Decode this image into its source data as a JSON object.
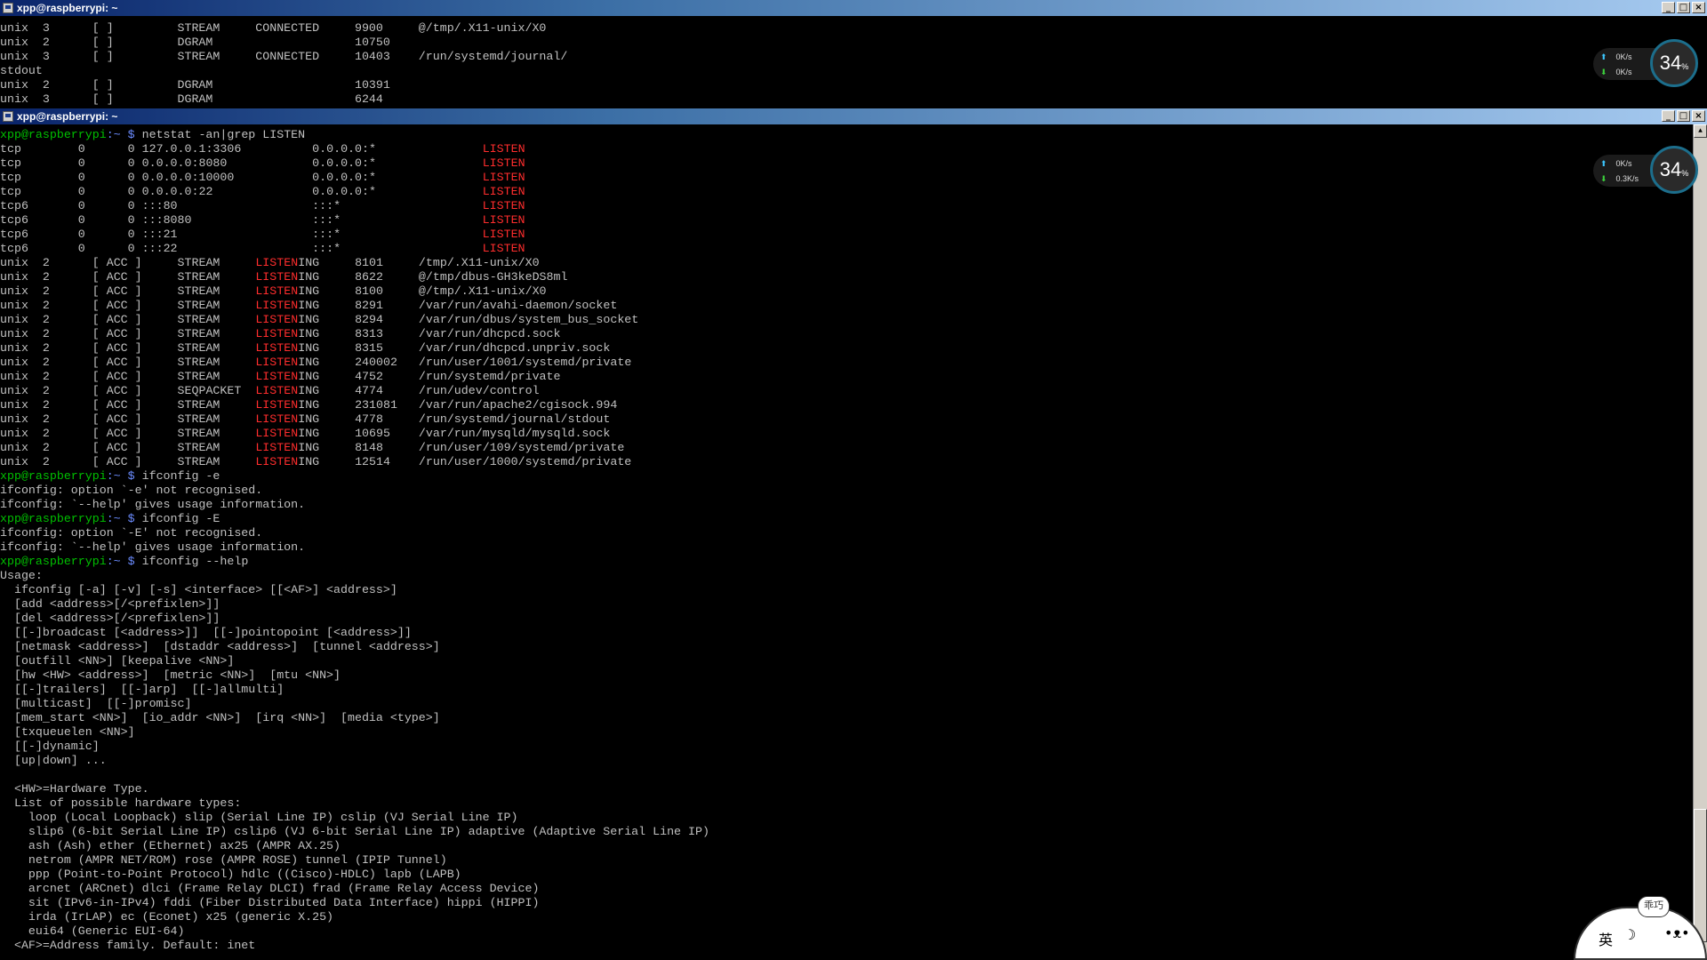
{
  "windows": [
    {
      "title": "xpp@raspberrypi: ~",
      "controls": {
        "minimize": "_",
        "maximize": "□",
        "close": "×"
      },
      "lines": [
        "unix  3      [ ]         STREAM     CONNECTED     9900     @/tmp/.X11-unix/X0",
        "unix  2      [ ]         DGRAM                    10750",
        "unix  3      [ ]         STREAM     CONNECTED     10403    /run/systemd/journal/",
        "stdout",
        "unix  2      [ ]         DGRAM                    10391",
        "unix  3      [ ]         DGRAM                    6244"
      ],
      "network": {
        "upload": "0K/s",
        "download": "0K/s",
        "gauge": "34",
        "gauge_unit": "%"
      }
    },
    {
      "title": "xpp@raspberrypi: ~",
      "controls": {
        "minimize": "_",
        "maximize": "□",
        "close": "×"
      },
      "network": {
        "upload": "0K/s",
        "download": "0.3K/s",
        "gauge": "34",
        "gauge_unit": "%"
      }
    }
  ],
  "prompt": {
    "user_host": "xpp@raspberrypi",
    "path": ":~ $ "
  },
  "commands": {
    "netstat": "netstat -an|grep LISTEN",
    "ifconfig_e": "ifconfig -e",
    "ifconfig_E": "ifconfig -E",
    "ifconfig_help": "ifconfig --help"
  },
  "tcp_listen": [
    {
      "proto": "tcp",
      "recvq": "0",
      "sendq": "0",
      "local": "127.0.0.1:3306",
      "foreign": "0.0.0.0:*",
      "state": "LISTEN"
    },
    {
      "proto": "tcp",
      "recvq": "0",
      "sendq": "0",
      "local": "0.0.0.0:8080",
      "foreign": "0.0.0.0:*",
      "state": "LISTEN"
    },
    {
      "proto": "tcp",
      "recvq": "0",
      "sendq": "0",
      "local": "0.0.0.0:10000",
      "foreign": "0.0.0.0:*",
      "state": "LISTEN"
    },
    {
      "proto": "tcp",
      "recvq": "0",
      "sendq": "0",
      "local": "0.0.0.0:22",
      "foreign": "0.0.0.0:*",
      "state": "LISTEN"
    },
    {
      "proto": "tcp6",
      "recvq": "0",
      "sendq": "0",
      "local": ":::80",
      "foreign": ":::*",
      "state": "LISTEN"
    },
    {
      "proto": "tcp6",
      "recvq": "0",
      "sendq": "0",
      "local": ":::8080",
      "foreign": ":::*",
      "state": "LISTEN"
    },
    {
      "proto": "tcp6",
      "recvq": "0",
      "sendq": "0",
      "local": ":::21",
      "foreign": ":::*",
      "state": "LISTEN"
    },
    {
      "proto": "tcp6",
      "recvq": "0",
      "sendq": "0",
      "local": ":::22",
      "foreign": ":::*",
      "state": "LISTEN"
    }
  ],
  "unix_listen": [
    {
      "proto": "unix",
      "refcnt": "2",
      "flags": "[ ACC ]",
      "type": "STREAM",
      "state": "LISTENING",
      "inode": "8101",
      "path": "/tmp/.X11-unix/X0"
    },
    {
      "proto": "unix",
      "refcnt": "2",
      "flags": "[ ACC ]",
      "type": "STREAM",
      "state": "LISTENING",
      "inode": "8622",
      "path": "@/tmp/dbus-GH3keDS8ml"
    },
    {
      "proto": "unix",
      "refcnt": "2",
      "flags": "[ ACC ]",
      "type": "STREAM",
      "state": "LISTENING",
      "inode": "8100",
      "path": "@/tmp/.X11-unix/X0"
    },
    {
      "proto": "unix",
      "refcnt": "2",
      "flags": "[ ACC ]",
      "type": "STREAM",
      "state": "LISTENING",
      "inode": "8291",
      "path": "/var/run/avahi-daemon/socket"
    },
    {
      "proto": "unix",
      "refcnt": "2",
      "flags": "[ ACC ]",
      "type": "STREAM",
      "state": "LISTENING",
      "inode": "8294",
      "path": "/var/run/dbus/system_bus_socket"
    },
    {
      "proto": "unix",
      "refcnt": "2",
      "flags": "[ ACC ]",
      "type": "STREAM",
      "state": "LISTENING",
      "inode": "8313",
      "path": "/var/run/dhcpcd.sock"
    },
    {
      "proto": "unix",
      "refcnt": "2",
      "flags": "[ ACC ]",
      "type": "STREAM",
      "state": "LISTENING",
      "inode": "8315",
      "path": "/var/run/dhcpcd.unpriv.sock"
    },
    {
      "proto": "unix",
      "refcnt": "2",
      "flags": "[ ACC ]",
      "type": "STREAM",
      "state": "LISTENING",
      "inode": "240002",
      "path": "/run/user/1001/systemd/private"
    },
    {
      "proto": "unix",
      "refcnt": "2",
      "flags": "[ ACC ]",
      "type": "STREAM",
      "state": "LISTENING",
      "inode": "4752",
      "path": "/run/systemd/private"
    },
    {
      "proto": "unix",
      "refcnt": "2",
      "flags": "[ ACC ]",
      "type": "SEQPACKET",
      "state": "LISTENING",
      "inode": "4774",
      "path": "/run/udev/control"
    },
    {
      "proto": "unix",
      "refcnt": "2",
      "flags": "[ ACC ]",
      "type": "STREAM",
      "state": "LISTENING",
      "inode": "231081",
      "path": "/var/run/apache2/cgisock.994"
    },
    {
      "proto": "unix",
      "refcnt": "2",
      "flags": "[ ACC ]",
      "type": "STREAM",
      "state": "LISTENING",
      "inode": "4778",
      "path": "/run/systemd/journal/stdout"
    },
    {
      "proto": "unix",
      "refcnt": "2",
      "flags": "[ ACC ]",
      "type": "STREAM",
      "state": "LISTENING",
      "inode": "10695",
      "path": "/var/run/mysqld/mysqld.sock"
    },
    {
      "proto": "unix",
      "refcnt": "2",
      "flags": "[ ACC ]",
      "type": "STREAM",
      "state": "LISTENING",
      "inode": "8148",
      "path": "/run/user/109/systemd/private"
    },
    {
      "proto": "unix",
      "refcnt": "2",
      "flags": "[ ACC ]",
      "type": "STREAM",
      "state": "LISTENING",
      "inode": "12514",
      "path": "/run/user/1000/systemd/private"
    }
  ],
  "errors": {
    "e": [
      "ifconfig: option `-e' not recognised.",
      "ifconfig: `--help' gives usage information."
    ],
    "E": [
      "ifconfig: option `-E' not recognised.",
      "ifconfig: `--help' gives usage information."
    ]
  },
  "help_lines": [
    "Usage:",
    "  ifconfig [-a] [-v] [-s] <interface> [[<AF>] <address>]",
    "  [add <address>[/<prefixlen>]]",
    "  [del <address>[/<prefixlen>]]",
    "  [[-]broadcast [<address>]]  [[-]pointopoint [<address>]]",
    "  [netmask <address>]  [dstaddr <address>]  [tunnel <address>]",
    "  [outfill <NN>] [keepalive <NN>]",
    "  [hw <HW> <address>]  [metric <NN>]  [mtu <NN>]",
    "  [[-]trailers]  [[-]arp]  [[-]allmulti]",
    "  [multicast]  [[-]promisc]",
    "  [mem_start <NN>]  [io_addr <NN>]  [irq <NN>]  [media <type>]",
    "  [txqueuelen <NN>]",
    "  [[-]dynamic]",
    "  [up|down] ...",
    "",
    "  <HW>=Hardware Type.",
    "  List of possible hardware types:",
    "    loop (Local Loopback) slip (Serial Line IP) cslip (VJ Serial Line IP)",
    "    slip6 (6-bit Serial Line IP) cslip6 (VJ 6-bit Serial Line IP) adaptive (Adaptive Serial Line IP)",
    "    ash (Ash) ether (Ethernet) ax25 (AMPR AX.25)",
    "    netrom (AMPR NET/ROM) rose (AMPR ROSE) tunnel (IPIP Tunnel)",
    "    ppp (Point-to-Point Protocol) hdlc ((Cisco)-HDLC) lapb (LAPB)",
    "    arcnet (ARCnet) dlci (Frame Relay DLCI) frad (Frame Relay Access Device)",
    "    sit (IPv6-in-IPv4) fddi (Fiber Distributed Data Interface) hippi (HIPPI)",
    "    irda (IrLAP) ec (Econet) x25 (generic X.25)",
    "    eui64 (Generic EUI-64)",
    "  <AF>=Address family. Default: inet"
  ],
  "mascot": {
    "bubble": "乖巧",
    "lang": "英",
    "moon": "☽",
    "face": "•ᴥ•"
  },
  "colors": {
    "prompt_user": "#00c000",
    "prompt_path": "#6b8cff",
    "listen": "#ff2d2d",
    "text": "#c0c0c0",
    "titlebar": "#0a246a"
  }
}
